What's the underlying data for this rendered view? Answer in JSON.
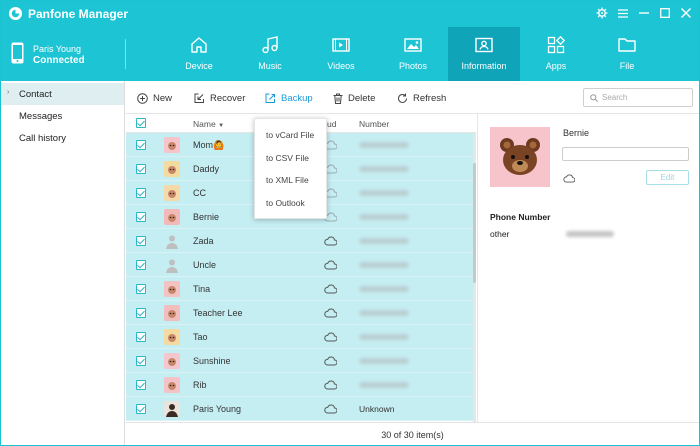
{
  "app": {
    "title": "Panfone Manager"
  },
  "device": {
    "name": "Paris Young",
    "status": "Connected"
  },
  "nav": [
    {
      "label": "Device",
      "icon": "home-icon"
    },
    {
      "label": "Music",
      "icon": "music-icon"
    },
    {
      "label": "Videos",
      "icon": "video-icon"
    },
    {
      "label": "Photos",
      "icon": "photo-icon"
    },
    {
      "label": "Information",
      "icon": "contact-card-icon",
      "active": true
    },
    {
      "label": "Apps",
      "icon": "apps-icon"
    },
    {
      "label": "File",
      "icon": "folder-icon"
    }
  ],
  "sidebar": {
    "items": [
      {
        "label": "Contact",
        "active": true
      },
      {
        "label": "Messages"
      },
      {
        "label": "Call history"
      }
    ]
  },
  "toolbar": {
    "new": "New",
    "recover": "Recover",
    "backup": "Backup",
    "delete": "Delete",
    "refresh": "Refresh"
  },
  "search": {
    "placeholder": "Search"
  },
  "table": {
    "col_name": "Name",
    "col_cloud": "ud",
    "col_number": "Number"
  },
  "contacts": [
    {
      "name": "Mom🙆"
    },
    {
      "name": "Daddy"
    },
    {
      "name": "CC"
    },
    {
      "name": "Bernie"
    },
    {
      "name": "Zada"
    },
    {
      "name": "Uncle"
    },
    {
      "name": "Tina"
    },
    {
      "name": "Teacher Lee"
    },
    {
      "name": "Tao"
    },
    {
      "name": "Sunshine"
    },
    {
      "name": "Rib"
    },
    {
      "name": "Paris Young",
      "number": "Unknown"
    }
  ],
  "backup_menu": [
    "to vCard File",
    "to CSV File",
    "to XML File",
    "to Outlook"
  ],
  "footer": {
    "count": "30 of 30 item(s)"
  },
  "detail": {
    "name": "Bernie",
    "edit": "Edit",
    "phone_label": "Phone Number",
    "phone_type": "other"
  },
  "colors": {
    "accent": "#1dc4d4",
    "active_tab": "#0fa4b7",
    "row_selected": "#c5eef3"
  }
}
